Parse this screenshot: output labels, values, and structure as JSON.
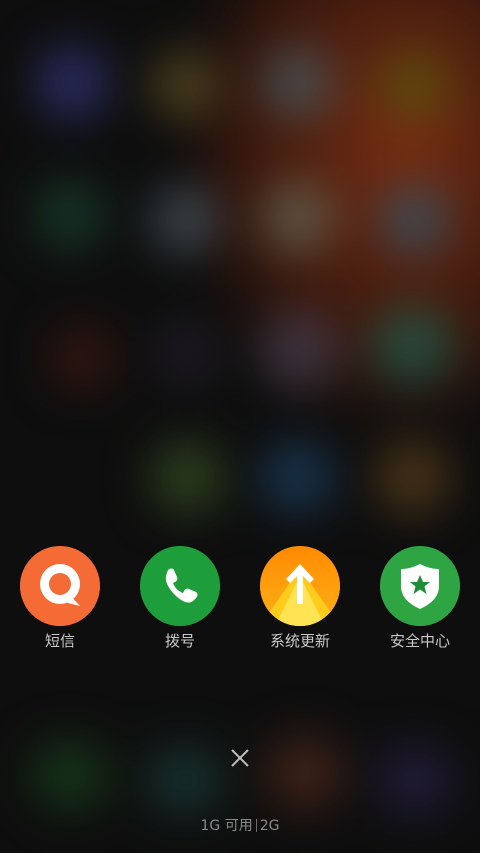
{
  "recent_tasks": {
    "apps": [
      {
        "label": "短信",
        "icon": "message-icon",
        "color": "#F46B35"
      },
      {
        "label": "拨号",
        "icon": "phone-icon",
        "color": "#1E9E3B"
      },
      {
        "label": "系统更新",
        "icon": "update-arrow-icon",
        "color": "#FF9A10"
      },
      {
        "label": "安全中心",
        "icon": "security-shield-icon",
        "color": "#2EA443"
      }
    ]
  },
  "clear_button": {
    "icon": "close-icon"
  },
  "memory": {
    "available": "1G 可用",
    "total": "2G"
  }
}
